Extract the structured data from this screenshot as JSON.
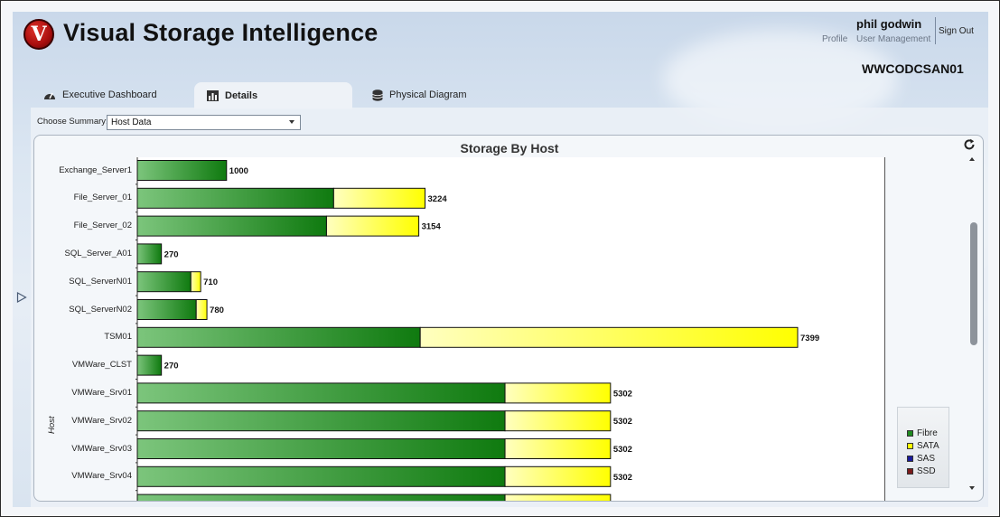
{
  "app": {
    "title": "Visual Storage Intelligence",
    "logo_letter": "V"
  },
  "user": {
    "name": "phil godwin",
    "sign_out": "Sign Out",
    "profile": "Profile",
    "user_management": "User Management",
    "system": "WWCODCSAN01"
  },
  "tabs": [
    {
      "label": "Executive Dashboard",
      "icon": "speedometer-icon",
      "active": false
    },
    {
      "label": "Details",
      "icon": "bar-chart-icon",
      "active": true
    },
    {
      "label": "Physical Diagram",
      "icon": "database-icon",
      "active": false
    }
  ],
  "summary": {
    "label": "Choose Summary:",
    "selected": "Host Data"
  },
  "colors": {
    "fibre": "#1f8a1f",
    "sata": "#ffff00",
    "sas": "#1a1a9a",
    "ssd": "#7a1a1a"
  },
  "chart_data": {
    "type": "bar",
    "orientation": "horizontal",
    "stacked": true,
    "title": "Storage By Host",
    "ylabel": "Host",
    "categories": [
      "Exchange_Server1",
      "File_Server_01",
      "File_Server_02",
      "SQL_Server_A01",
      "SQL_ServerN01",
      "SQL_ServerN02",
      "TSM01",
      "VMWare_CLST",
      "VMWare_Srv01",
      "VMWare_Srv02",
      "VMWare_Srv03",
      "VMWare_Srv04"
    ],
    "totals": [
      "1000",
      "3224",
      "3154",
      "270",
      "710",
      "780",
      "7399",
      "270",
      "5302",
      "5302",
      "5302",
      "5302"
    ],
    "series": [
      {
        "name": "Fibre",
        "values": [
          1000,
          2200,
          2120,
          270,
          600,
          660,
          3170,
          270,
          4120,
          4120,
          4120,
          4120
        ]
      },
      {
        "name": "SATA",
        "values": [
          0,
          1024,
          1034,
          0,
          110,
          120,
          4229,
          0,
          1182,
          1182,
          1182,
          1182
        ]
      },
      {
        "name": "SAS",
        "values": [
          0,
          0,
          0,
          0,
          0,
          0,
          0,
          0,
          0,
          0,
          0,
          0
        ]
      },
      {
        "name": "SSD",
        "values": [
          0,
          0,
          0,
          0,
          0,
          0,
          0,
          0,
          0,
          0,
          0,
          0
        ]
      }
    ],
    "xlim": [
      0,
      8300
    ],
    "legend": "right"
  }
}
